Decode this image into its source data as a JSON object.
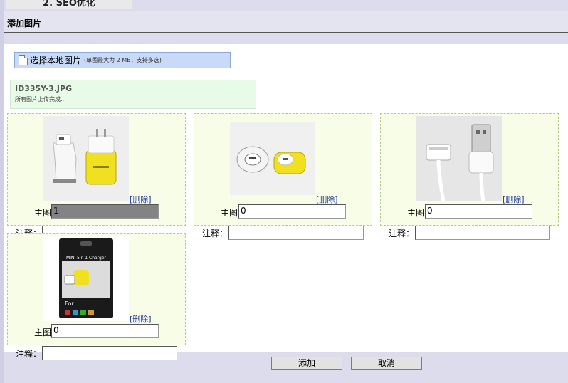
{
  "top_tab": {
    "label": "2. SEO优化"
  },
  "section": {
    "title": "添加图片"
  },
  "upload": {
    "label": "选择本地图片",
    "hint": "(单图最大为 2 MB，支持多选)"
  },
  "status": {
    "file_name": "ID335Y-3.JPG",
    "message": "所有图片上传完成..."
  },
  "images": [
    {
      "delete_label": "[删除]",
      "main_label": "主图",
      "main_value": "1",
      "note_label": "注释：",
      "note_value": ""
    },
    {
      "delete_label": "[删除]",
      "main_label": "主图",
      "main_value": "0",
      "note_label": "注释：",
      "note_value": ""
    },
    {
      "delete_label": "[删除]",
      "main_label": "主图",
      "main_value": "0",
      "note_label": "注释：",
      "note_value": ""
    },
    {
      "delete_label": "[删除]",
      "main_label": "主图",
      "main_value": "0",
      "note_label": "注释：",
      "note_value": ""
    }
  ],
  "package_text": {
    "line1": "MINI 5in 1 Charger",
    "line2": "For"
  },
  "actions": {
    "add_label": "添加",
    "cancel_label": "取消"
  }
}
